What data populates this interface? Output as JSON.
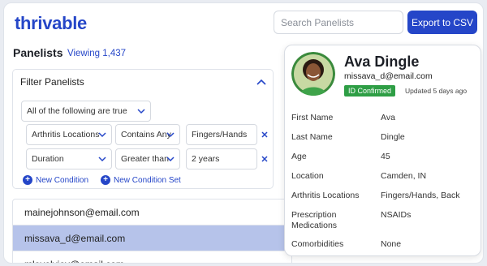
{
  "brand": {
    "logo": "thrivable"
  },
  "header": {
    "search_placeholder": "Search Panelists",
    "export_label": "Export to CSV"
  },
  "panelists": {
    "title": "Panelists",
    "viewing": "Viewing 1,437"
  },
  "filter": {
    "title": "Filter Panelists",
    "match": "All of the following are true",
    "conditions": [
      {
        "field": "Arthritis Locations",
        "operator": "Contains Any",
        "value": "Fingers/Hands"
      },
      {
        "field": "Duration",
        "operator": "Greater than",
        "value": "2 years"
      }
    ],
    "add_condition": "New Condition",
    "add_condition_set": "New Condition Set"
  },
  "list": {
    "rows": [
      {
        "email": "mainejohnson@email.com",
        "selected": false
      },
      {
        "email": "missava_d@email.com",
        "selected": true
      },
      {
        "email": "mlovelyjov@email.com",
        "selected": false
      }
    ]
  },
  "profile": {
    "name": "Ava Dingle",
    "email": "missava_d@email.com",
    "badge": "ID Confirmed",
    "updated": "Updated 5 days ago",
    "fields": [
      {
        "label": "First Name",
        "value": "Ava"
      },
      {
        "label": "Last Name",
        "value": "Dingle"
      },
      {
        "label": "Age",
        "value": "45"
      },
      {
        "label": "Location",
        "value": "Camden, IN"
      },
      {
        "label": "Arthritis Locations",
        "value": "Fingers/Hands, Back"
      },
      {
        "label": "Prescription Medications",
        "value": "NSAIDs"
      },
      {
        "label": "Comorbidities",
        "value": "None"
      }
    ]
  },
  "colors": {
    "brand": "#2546c8",
    "selected_row": "#b6c3ea",
    "badge_green": "#2e9e45"
  },
  "icons": [
    "chevron-up-icon",
    "chevron-down-icon",
    "close-icon",
    "plus-icon"
  ]
}
